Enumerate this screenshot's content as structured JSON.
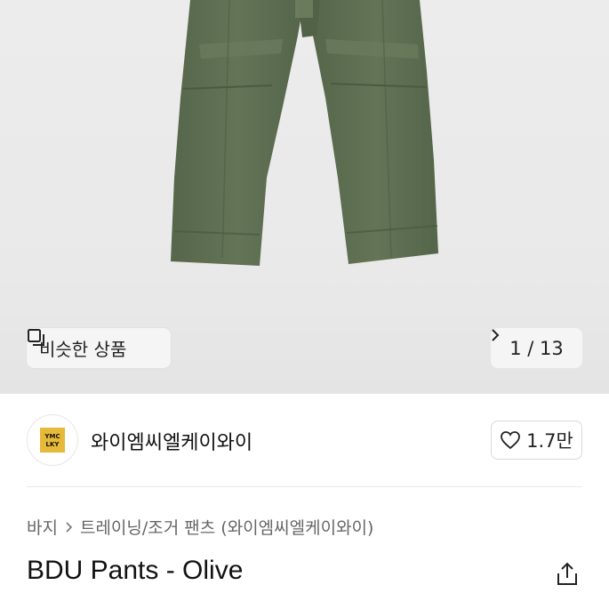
{
  "gallery": {
    "similar_label": "비슷한 상품",
    "counter": "1 / 13"
  },
  "store": {
    "logo_text": "YMC LKY",
    "name": "와이엠씨엘케이와이",
    "likes": "1.7만"
  },
  "breadcrumb": {
    "category": "바지",
    "subcategory": "트레이닝/조거 팬츠 (와이엠씨엘케이와이)"
  },
  "product": {
    "title": "BDU Pants - Olive"
  },
  "colors": {
    "pants": "#5b6b4c",
    "logo": "#e7b93a"
  }
}
